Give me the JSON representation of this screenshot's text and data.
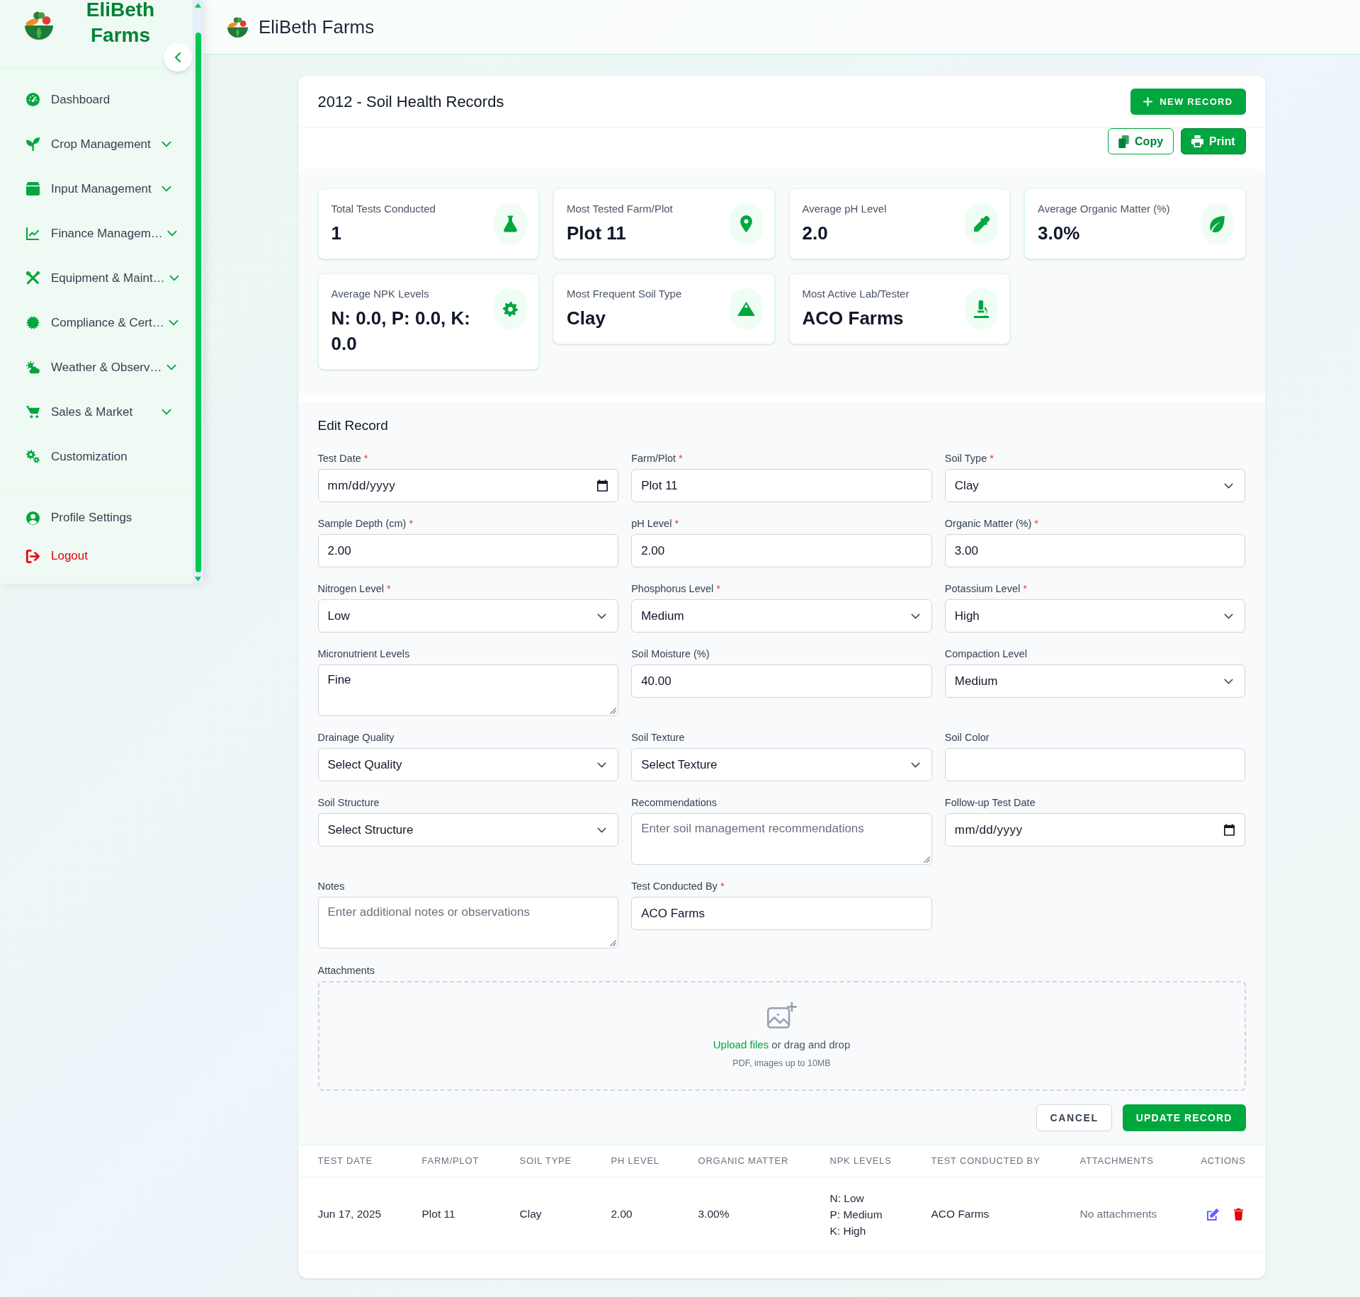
{
  "sidebar": {
    "brand": "EliBeth Farms",
    "items": [
      {
        "label": "Dashboard",
        "kind": "link",
        "selected": false
      },
      {
        "label": "Crop Management",
        "kind": "group",
        "expanded": false,
        "selected": false
      },
      {
        "label": "Input Management",
        "kind": "group",
        "expanded": false,
        "selected": false
      },
      {
        "label": "Finance Managem…",
        "kind": "group",
        "expanded": false,
        "selected": false
      },
      {
        "label": "Equipment & Maint…",
        "kind": "group",
        "expanded": false,
        "selected": false
      },
      {
        "label": "Compliance & Cert…",
        "kind": "group",
        "expanded": false,
        "selected": false
      },
      {
        "label": "Weather & Observ…",
        "kind": "group",
        "expanded": false,
        "selected": false
      },
      {
        "label": "Sales & Market",
        "kind": "group",
        "expanded": false,
        "selected": false
      },
      {
        "label": "Customization",
        "kind": "link",
        "selected": false
      }
    ],
    "footer_items": [
      {
        "label": "Profile Settings",
        "kind": "link",
        "selected": false
      },
      {
        "label": "Logout",
        "kind": "logout",
        "selected": false
      }
    ]
  },
  "header": {
    "title": "EliBeth Farms"
  },
  "page": {
    "title": "2012 - Soil Health Records",
    "new_record_button": "NEW RECORD",
    "copy_button": "Copy",
    "print_button": "Print"
  },
  "stats": [
    {
      "label": "Total Tests Conducted",
      "value": "1"
    },
    {
      "label": "Most Tested Farm/Plot",
      "value": "Plot 11"
    },
    {
      "label": "Average pH Level",
      "value": "2.0"
    },
    {
      "label": "Average Organic Matter (%)",
      "value": "3.0%"
    },
    {
      "label": "Average NPK Levels",
      "value": "N: 0.0, P: 0.0, K: 0.0"
    },
    {
      "label": "Most Frequent Soil Type",
      "value": "Clay"
    },
    {
      "label": "Most Active Lab/Tester",
      "value": "ACO Farms"
    }
  ],
  "form": {
    "title": "Edit Record",
    "required_mark": "*",
    "fields": [
      {
        "label": "Test Date",
        "required": true,
        "kind": "date",
        "placeholder": "mm/dd/yyyy"
      },
      {
        "label": "Farm/Plot",
        "required": true,
        "kind": "text",
        "value": "Plot 11"
      },
      {
        "label": "Soil Type",
        "required": true,
        "kind": "select",
        "value": "Clay"
      },
      {
        "label": "Sample Depth (cm)",
        "required": true,
        "kind": "text",
        "value": "2.00"
      },
      {
        "label": "pH Level",
        "required": true,
        "kind": "text",
        "value": "2.00"
      },
      {
        "label": "Organic Matter (%)",
        "required": true,
        "kind": "text",
        "value": "3.00"
      },
      {
        "label": "Nitrogen Level",
        "required": true,
        "kind": "select",
        "value": "Low"
      },
      {
        "label": "Phosphorus Level",
        "required": true,
        "kind": "select",
        "value": "Medium"
      },
      {
        "label": "Potassium Level",
        "required": true,
        "kind": "select",
        "value": "High"
      },
      {
        "label": "Micronutrient Levels",
        "required": false,
        "kind": "textarea",
        "value": "Fine"
      },
      {
        "label": "Soil Moisture (%)",
        "required": false,
        "kind": "text",
        "value": "40.00"
      },
      {
        "label": "Compaction Level",
        "required": false,
        "kind": "select",
        "value": "Medium"
      },
      {
        "label": "Drainage Quality",
        "required": false,
        "kind": "select",
        "value": "Select Quality"
      },
      {
        "label": "Soil Texture",
        "required": false,
        "kind": "select",
        "value": "Select Texture"
      },
      {
        "label": "Soil Color",
        "required": false,
        "kind": "text"
      },
      {
        "label": "Soil Structure",
        "required": false,
        "kind": "select",
        "value": "Select Structure"
      },
      {
        "label": "Recommendations",
        "required": false,
        "kind": "textarea",
        "placeholder": "Enter soil management recommendations"
      },
      {
        "label": "Follow-up Test Date",
        "required": false,
        "kind": "date",
        "placeholder": "mm/dd/yyyy"
      },
      {
        "label": "Notes",
        "required": false,
        "kind": "textarea",
        "placeholder": "Enter additional notes or observations"
      },
      {
        "label": "Test Conducted By",
        "required": true,
        "kind": "text",
        "value": "ACO Farms"
      }
    ],
    "attachments": {
      "label": "Attachments",
      "link": "Upload files",
      "text": "or drag and drop",
      "hint": "PDF, images up to 10MB"
    },
    "buttons": [
      {
        "label": "CANCEL",
        "kind": "secondary"
      },
      {
        "label": "UPDATE RECORD",
        "kind": "primary"
      }
    ]
  },
  "table": {
    "columns": [
      "TEST DATE",
      "FARM/PLOT",
      "SOIL TYPE",
      "PH LEVEL",
      "ORGANIC MATTER",
      "NPK LEVELS",
      "TEST CONDUCTED BY",
      "ATTACHMENTS",
      "ACTIONS"
    ],
    "rows": [
      {
        "cells": [
          {
            "kind": "text",
            "text": "Jun 17, 2025"
          },
          {
            "kind": "text",
            "text": "Plot 11"
          },
          {
            "kind": "text",
            "text": "Clay"
          },
          {
            "kind": "text",
            "text": "2.00"
          },
          {
            "kind": "text",
            "text": "3.00%"
          },
          {
            "kind": "lines",
            "lines": [
              "N: Low",
              "P: Medium",
              "K: High"
            ]
          },
          {
            "kind": "text",
            "text": "ACO Farms"
          },
          {
            "kind": "muted",
            "text": "No attachments"
          }
        ]
      }
    ]
  }
}
